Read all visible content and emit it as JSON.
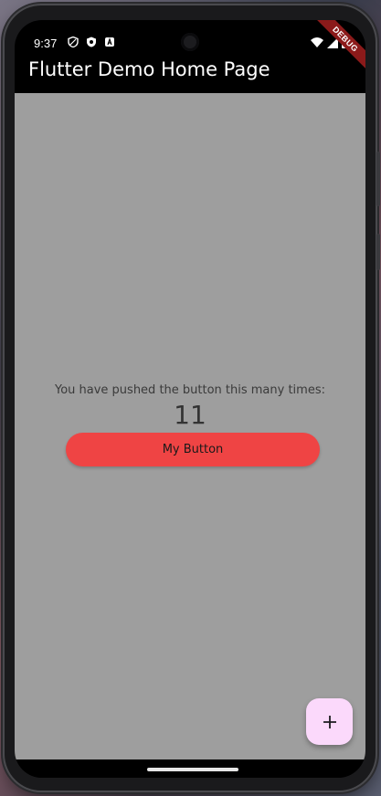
{
  "status_bar": {
    "time": "9:37",
    "left_icons": [
      "shield-icon",
      "vpn-badge-icon",
      "app-notification-icon"
    ],
    "right_icons": [
      "wifi-icon",
      "signal-icon",
      "battery-icon"
    ]
  },
  "debug_banner": "DEBUG",
  "app_bar": {
    "title": "Flutter Demo Home Page"
  },
  "main": {
    "counter_label": "You have pushed the button this many times:",
    "counter_value": "11",
    "button_label": "My Button"
  },
  "fab": {
    "icon": "plus-icon",
    "color": "#fbd9fb"
  },
  "colors": {
    "body_background": "#9e9e9e",
    "button": "#ef4444",
    "app_bar": "#000000",
    "debug_ribbon": "#8b1a1a"
  }
}
